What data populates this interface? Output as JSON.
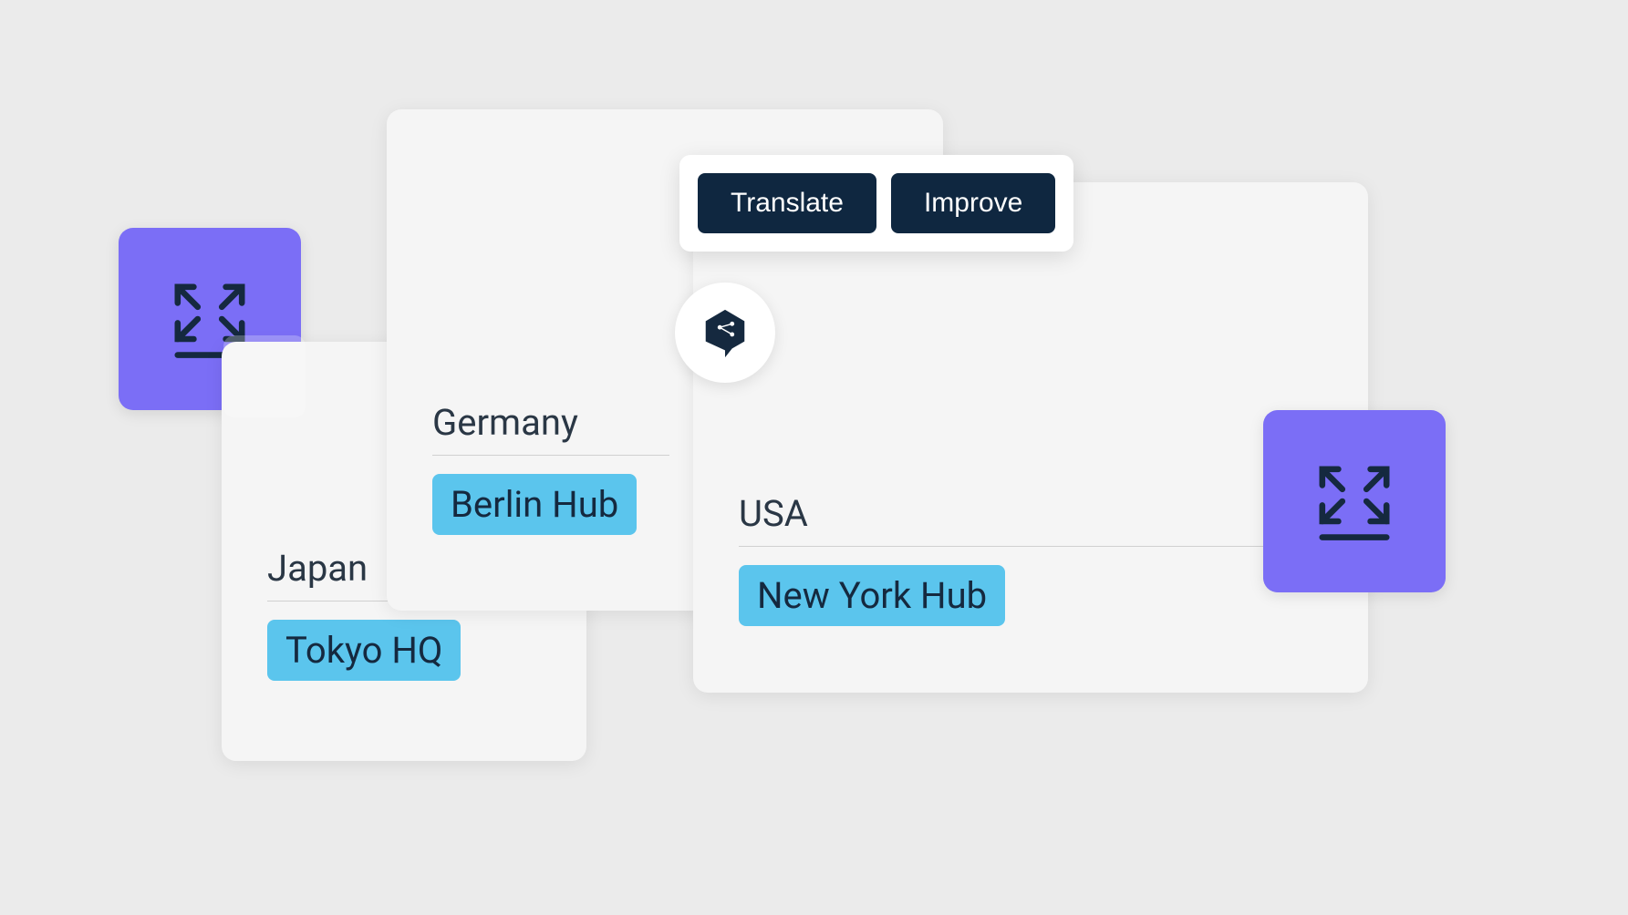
{
  "toolbar": {
    "translate_label": "Translate",
    "improve_label": "Improve"
  },
  "cards": {
    "germany": {
      "country": "Germany",
      "hub": "Berlin Hub"
    },
    "japan": {
      "country": "Japan",
      "hub": "Tokyo HQ"
    },
    "usa": {
      "country": "USA",
      "hub": "New York Hub"
    }
  },
  "icons": {
    "expand_left": "expand-icon",
    "expand_right": "expand-icon",
    "chat": "chat-hexagon-icon"
  },
  "colors": {
    "accent_purple": "#7b6ef6",
    "accent_blue": "#5bc5ed",
    "button_dark": "#0f2740",
    "text_dark": "#2a3745"
  }
}
